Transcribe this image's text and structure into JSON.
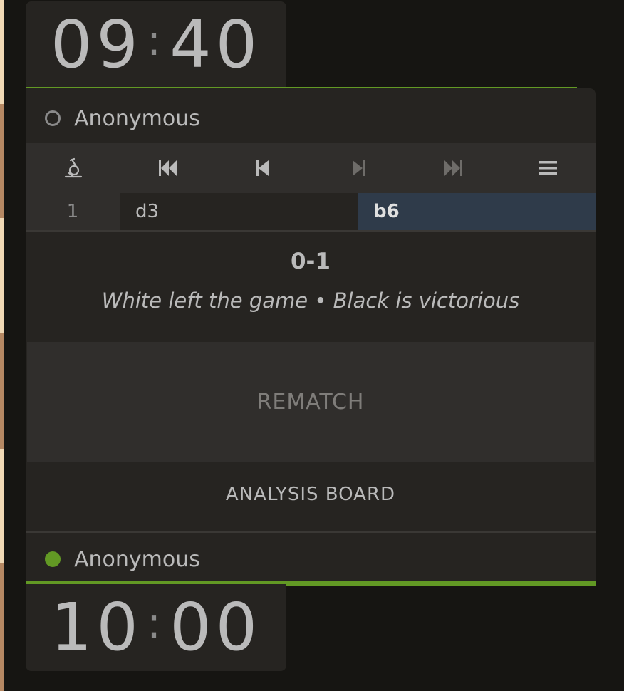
{
  "colors": {
    "background": "#161512",
    "panel": "#262421",
    "accent_green": "#629924",
    "active_move": "#2f3b4a",
    "board_light": "#f0d9b5",
    "board_dark": "#b58863"
  },
  "clocks": {
    "top": {
      "minutes": "09",
      "separator": ":",
      "seconds": "40"
    },
    "bottom": {
      "minutes": "10",
      "separator": ":",
      "seconds": "00"
    }
  },
  "players": {
    "top": {
      "name": "Anonymous",
      "status": "offline"
    },
    "bottom": {
      "name": "Anonymous",
      "status": "online"
    }
  },
  "controls": [
    {
      "icon": "microscope-icon"
    },
    {
      "icon": "first-move-icon"
    },
    {
      "icon": "previous-move-icon"
    },
    {
      "icon": "next-move-icon"
    },
    {
      "icon": "last-move-icon"
    },
    {
      "icon": "menu-icon"
    }
  ],
  "moves": [
    {
      "number": "1",
      "white": "d3",
      "black": "b6"
    }
  ],
  "result": {
    "score": "0-1",
    "status": "White left the game • Black is victorious"
  },
  "buttons": {
    "rematch": "REMATCH",
    "analysis": "ANALYSIS BOARD"
  }
}
